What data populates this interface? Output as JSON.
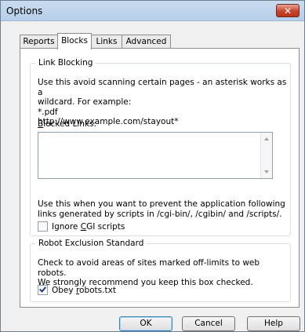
{
  "window": {
    "title": "Options",
    "close_label": "✕"
  },
  "tabs": [
    {
      "label": "Reports",
      "active": false
    },
    {
      "label": "Blocks",
      "active": true
    },
    {
      "label": "Links",
      "active": false
    },
    {
      "label": "Advanced",
      "active": false
    }
  ],
  "link_blocking": {
    "legend": "Link Blocking",
    "description": "Use this avoid scanning certain pages - an asterisk works as a\nwildcard. For example:\n*.pdf\nhttp://www.example.com/stayout*",
    "blocked_label": "Blocked Links:",
    "blocked_value": "",
    "cgi_description": "Use this when you want to prevent the application following\nlinks generated by scripts in /cgi-bin/, /cgibin/ and /scripts/.",
    "cgi_checkbox_label": "Ignore CGI scripts",
    "cgi_checked": false
  },
  "robot_exclusion": {
    "legend": "Robot Exclusion Standard",
    "description": "Check to avoid areas of sites marked off-limits to web robots.\nWe strongly recommend you keep this box checked.",
    "checkbox_label": "Obey robots.txt",
    "checked": true
  },
  "buttons": {
    "ok": "OK",
    "cancel": "Cancel",
    "help": "Help"
  }
}
